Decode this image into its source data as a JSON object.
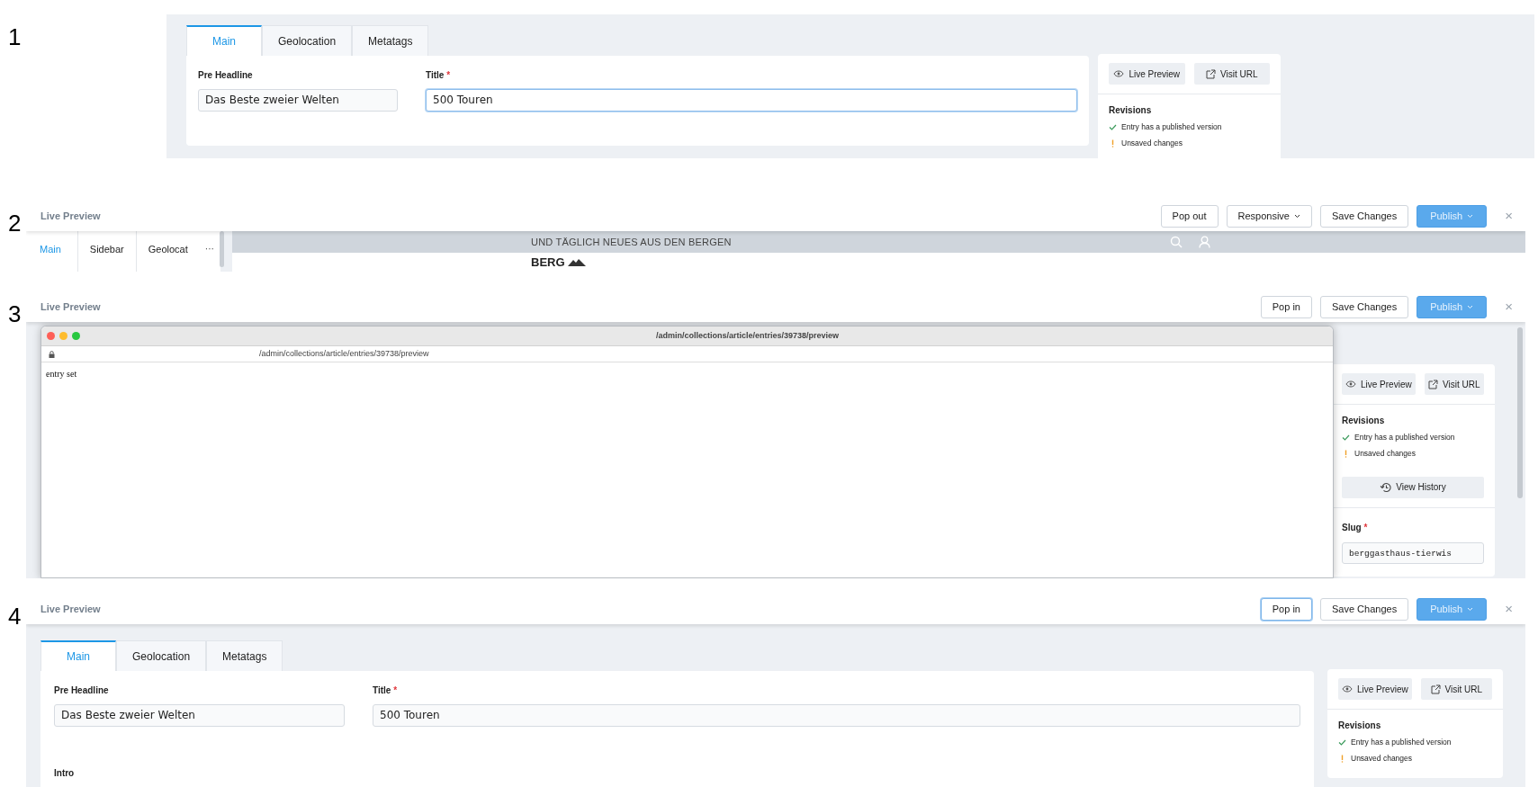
{
  "panels": [
    {
      "number": "1",
      "kind": "editor",
      "tabs": [
        {
          "label": "Main",
          "selected": true
        },
        {
          "label": "Geolocation",
          "selected": false
        },
        {
          "label": "Metatags",
          "selected": false
        }
      ],
      "fields": [
        {
          "label": "Pre Headline",
          "value": "Das Beste zweier Welten",
          "focused": false
        },
        {
          "label": "Title",
          "required_mark": "*",
          "value": "500 Touren",
          "focused": true
        }
      ],
      "sidebar": {
        "actions": [
          {
            "label": "Live Preview",
            "kind": "preview"
          },
          {
            "label": "Visit URL",
            "kind": "link"
          }
        ],
        "revisions_heading": "Revisions",
        "revisions": [
          {
            "text": "Entry has a published version",
            "kind": "published"
          },
          {
            "text": "Unsaved changes",
            "kind": "unsaved"
          }
        ]
      }
    },
    {
      "number": "2",
      "kind": "inline_preview",
      "toolbar": {
        "title": "Live Preview",
        "buttons": [
          {
            "label": "Pop out",
            "kind": "plain",
            "focused": false
          },
          {
            "label": "Responsive",
            "kind": "dropdown",
            "focused": false
          },
          {
            "label": "Save Changes",
            "kind": "plain",
            "focused": false
          },
          {
            "label": "Publish",
            "kind": "primary",
            "focused": false
          }
        ],
        "close": "×"
      },
      "tabs": [
        {
          "label": "Main",
          "selected": true
        },
        {
          "label": "Sidebar",
          "selected": false
        },
        {
          "label": "Geolocat",
          "selected": false
        }
      ],
      "more": "···",
      "site": {
        "banner": "UND TÄGLICH NEUES AUS DEN BERGEN",
        "logo": "BERG"
      }
    },
    {
      "number": "3",
      "kind": "popout_preview",
      "toolbar": {
        "title": "Live Preview",
        "buttons": [
          {
            "label": "Pop in",
            "kind": "plain",
            "focused": false
          },
          {
            "label": "Save Changes",
            "kind": "plain",
            "focused": false
          },
          {
            "label": "Publish",
            "kind": "primary",
            "focused": false
          }
        ],
        "close": "×"
      },
      "window": {
        "title": "/admin/collections/article/entries/39738/preview",
        "url": "/admin/collections/article/entries/39738/preview",
        "body": "entry set"
      },
      "sidebar": {
        "actions": [
          {
            "label": "Live Preview",
            "kind": "preview"
          },
          {
            "label": "Visit URL",
            "kind": "link"
          }
        ],
        "revisions_heading": "Revisions",
        "revisions": [
          {
            "text": "Entry has a published version",
            "kind": "published"
          },
          {
            "text": "Unsaved changes",
            "kind": "unsaved"
          }
        ],
        "history": "View History",
        "slug": {
          "label": "Slug",
          "required_mark": "*",
          "value": "berggasthaus-tierwis"
        }
      }
    },
    {
      "number": "4",
      "kind": "editor",
      "toolbar": {
        "title": "Live Preview",
        "buttons": [
          {
            "label": "Pop in",
            "kind": "plain",
            "focused": true
          },
          {
            "label": "Save Changes",
            "kind": "plain",
            "focused": false
          },
          {
            "label": "Publish",
            "kind": "primary",
            "focused": false
          }
        ],
        "close": "×"
      },
      "tabs": [
        {
          "label": "Main",
          "selected": true
        },
        {
          "label": "Geolocation",
          "selected": false
        },
        {
          "label": "Metatags",
          "selected": false
        }
      ],
      "fields": [
        {
          "label": "Pre Headline",
          "value": "Das Beste zweier Welten",
          "focused": false
        },
        {
          "label": "Title",
          "required_mark": "*",
          "value": "500 Touren",
          "focused": false
        }
      ],
      "next_field": "Intro",
      "sidebar": {
        "actions": [
          {
            "label": "Live Preview",
            "kind": "preview"
          },
          {
            "label": "Visit URL",
            "kind": "link"
          }
        ],
        "revisions_heading": "Revisions",
        "revisions": [
          {
            "text": "Entry has a published version",
            "kind": "published"
          },
          {
            "text": "Unsaved changes",
            "kind": "unsaved"
          }
        ]
      }
    }
  ]
}
